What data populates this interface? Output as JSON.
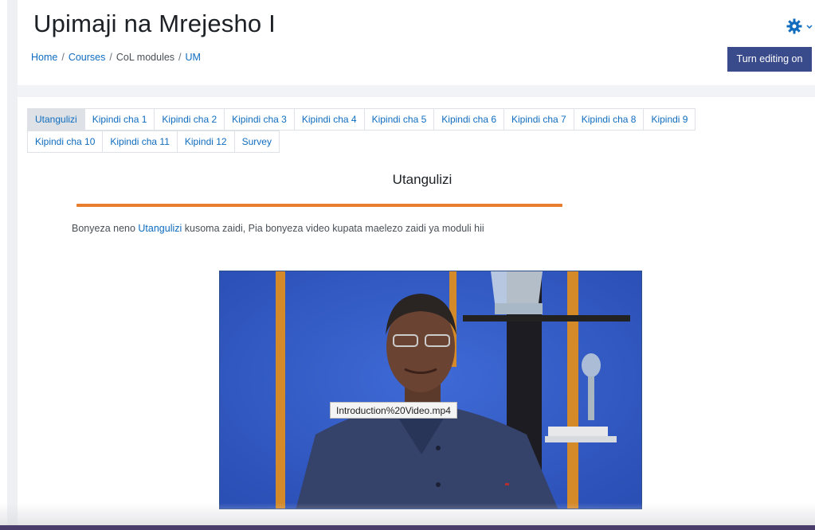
{
  "header": {
    "title": "Upimaji na Mrejesho I",
    "breadcrumb": [
      {
        "label": "Home",
        "link": true
      },
      {
        "label": "Courses",
        "link": true
      },
      {
        "label": "CoL modules",
        "link": false
      },
      {
        "label": "UM",
        "link": true
      }
    ],
    "settings_icon": "gear-icon",
    "edit_button": "Turn editing on"
  },
  "tabs": {
    "row1": [
      "Utangulizi",
      "Kipindi cha 1",
      "Kipindi cha 2",
      "Kipindi cha 3",
      "Kipindi cha 4",
      "Kipindi cha 5",
      "Kipindi cha 6",
      "Kipindi cha 7",
      "Kipindi cha 8",
      "Kipindi 9"
    ],
    "row2": [
      "Kipindi cha 10",
      "Kipindi cha 11",
      "Kipindi 12",
      "Survey"
    ],
    "active": "Utangulizi"
  },
  "section": {
    "title": "Utangulizi",
    "text_before": "Bonyeza neno ",
    "link": "Utangulizi",
    "text_after": " kusoma zaidi, Pia bonyeza video kupata maelezo zaidi ya moduli hii"
  },
  "video": {
    "tooltip": "Introduction%20Video.mp4"
  },
  "colors": {
    "accent": "#0f6cbf",
    "button": "#3a4b8c",
    "rule": "#e87d2d"
  }
}
